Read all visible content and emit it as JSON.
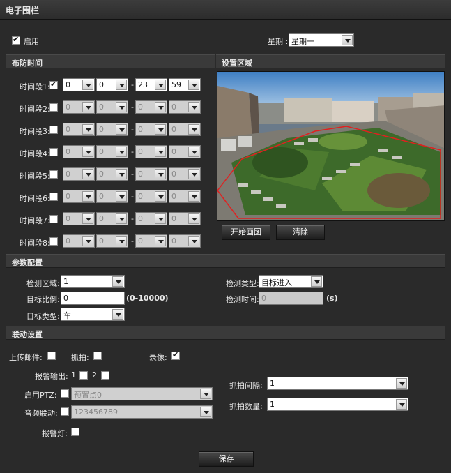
{
  "window": {
    "title": "电子围栏"
  },
  "enable": {
    "label": "启用",
    "checked": true
  },
  "weekday": {
    "label": "星期 :",
    "value": "星期一"
  },
  "schedule": {
    "header": "布防时间",
    "periods": [
      {
        "label": "时间段1:",
        "checked": true,
        "start_h": "0",
        "start_m": "0",
        "end_h": "23",
        "end_m": "59"
      },
      {
        "label": "时间段2:",
        "checked": false,
        "start_h": "0",
        "start_m": "0",
        "end_h": "0",
        "end_m": "0"
      },
      {
        "label": "时间段3:",
        "checked": false,
        "start_h": "0",
        "start_m": "0",
        "end_h": "0",
        "end_m": "0"
      },
      {
        "label": "时间段4:",
        "checked": false,
        "start_h": "0",
        "start_m": "0",
        "end_h": "0",
        "end_m": "0"
      },
      {
        "label": "时间段5:",
        "checked": false,
        "start_h": "0",
        "start_m": "0",
        "end_h": "0",
        "end_m": "0"
      },
      {
        "label": "时间段6:",
        "checked": false,
        "start_h": "0",
        "start_m": "0",
        "end_h": "0",
        "end_m": "0"
      },
      {
        "label": "时间段7:",
        "checked": false,
        "start_h": "0",
        "start_m": "0",
        "end_h": "0",
        "end_m": "0"
      },
      {
        "label": "时间段8:",
        "checked": false,
        "start_h": "0",
        "start_m": "0",
        "end_h": "0",
        "end_m": "0"
      }
    ],
    "dash": "-"
  },
  "area": {
    "header": "设置区域",
    "start_draw": "开始画图",
    "clear": "清除"
  },
  "params": {
    "header": "参数配置",
    "detect_area_label": "检测区域:",
    "detect_area_value": "1",
    "detect_type_label": "检测类型:",
    "detect_type_value": "目标进入",
    "target_ratio_label": "目标比例:",
    "target_ratio_value": "0",
    "target_ratio_hint": "(0-10000)",
    "detect_time_label": "检测时间:",
    "detect_time_value": "0",
    "detect_time_unit": "(s)",
    "target_type_label": "目标类型:",
    "target_type_value": "车"
  },
  "linkage": {
    "header": "联动设置",
    "email_label": "上传邮件:",
    "email_checked": false,
    "snap_label": "抓拍:",
    "snap_checked": false,
    "record_label": "录像:",
    "record_checked": true,
    "alarm_out_label": "报警输出:",
    "out1_label": "1",
    "out2_label": "2",
    "ptz_label": "启用PTZ:",
    "ptz_value": "预置点0",
    "audio_label": "音频联动:",
    "audio_value": "123456789",
    "light_label": "报警灯:",
    "interval_label": "抓拍间隔:",
    "interval_value": "1",
    "count_label": "抓拍数量:",
    "count_value": "1"
  },
  "footer": {
    "save": "保存"
  },
  "colors": {
    "background": "#2a2a2a",
    "section": "#3a3a3a",
    "fence": "#e02020"
  }
}
